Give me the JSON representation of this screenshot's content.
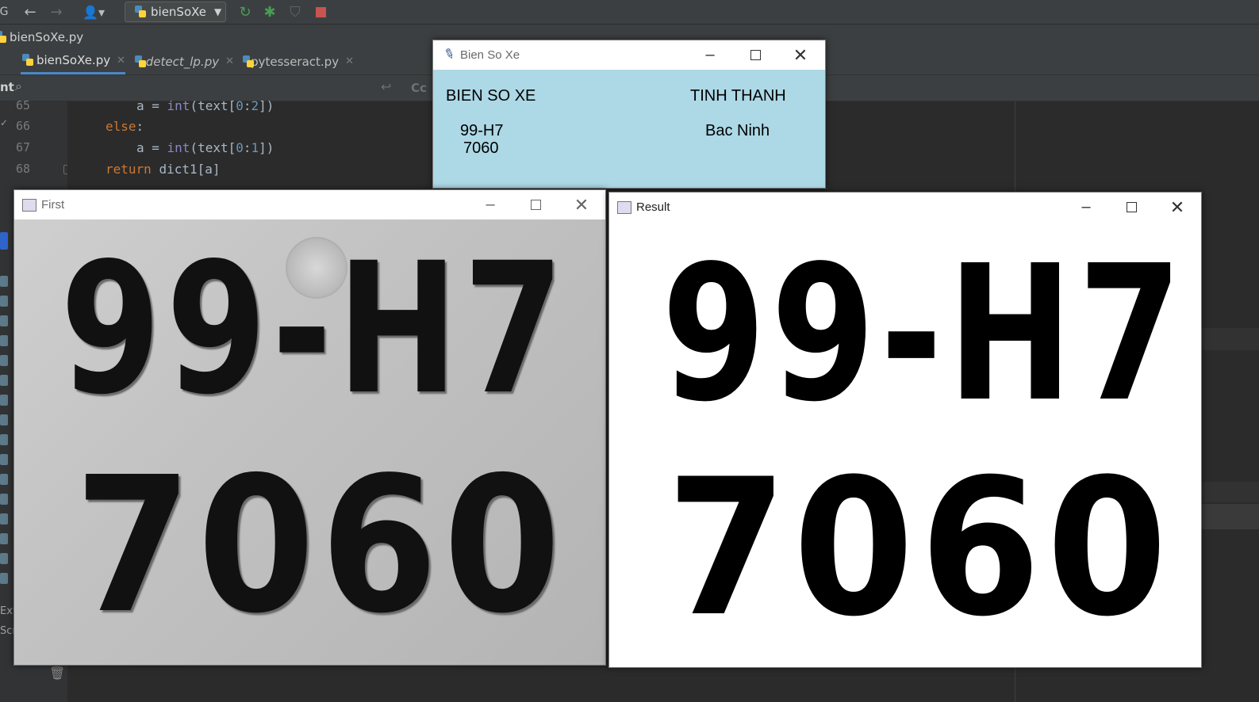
{
  "ide": {
    "run_config_label": "bienSoXe",
    "breadcrumb_file": "bienSoXe.py",
    "tabs": [
      {
        "label": "bienSoXe.py",
        "active": true
      },
      {
        "label": "detect_lp.py",
        "active": false
      },
      {
        "label": "pytesseract.py",
        "active": false
      }
    ],
    "left_panel_partial_label": "nt",
    "findbar_case_label": "Cc",
    "code_lines": [
      {
        "number": "65",
        "text": "a = int(text[0:2])"
      },
      {
        "number": "66",
        "text": "else:"
      },
      {
        "number": "67",
        "text": "a = int(text[0:1])"
      },
      {
        "number": "68",
        "text": "return dict1[a]"
      }
    ],
    "side_labels": [
      "Ext",
      "Scr"
    ]
  },
  "bien_so_xe_window": {
    "title": "Bien So Xe",
    "header_plate": "BIEN SO XE",
    "header_province": "TINH THANH",
    "plate_line1": "99-H7",
    "plate_line2": "7060",
    "province_value": "Bac Ninh"
  },
  "first_window": {
    "title": "First",
    "plate_top": "99-H7",
    "plate_bottom": "7060",
    "style": "grayscale photo"
  },
  "result_window": {
    "title": "Result",
    "plate_top": "99-H7",
    "plate_bottom": "7060",
    "style": "binary threshold"
  },
  "colors": {
    "ide_bg": "#2b2b2b",
    "ide_panel": "#3c3f41",
    "tk_bg": "#add8e6",
    "keyword": "#cc7832",
    "builtin": "#8888c6",
    "number": "#6897bb",
    "run_green": "#499c54",
    "stop_red": "#c75450"
  }
}
